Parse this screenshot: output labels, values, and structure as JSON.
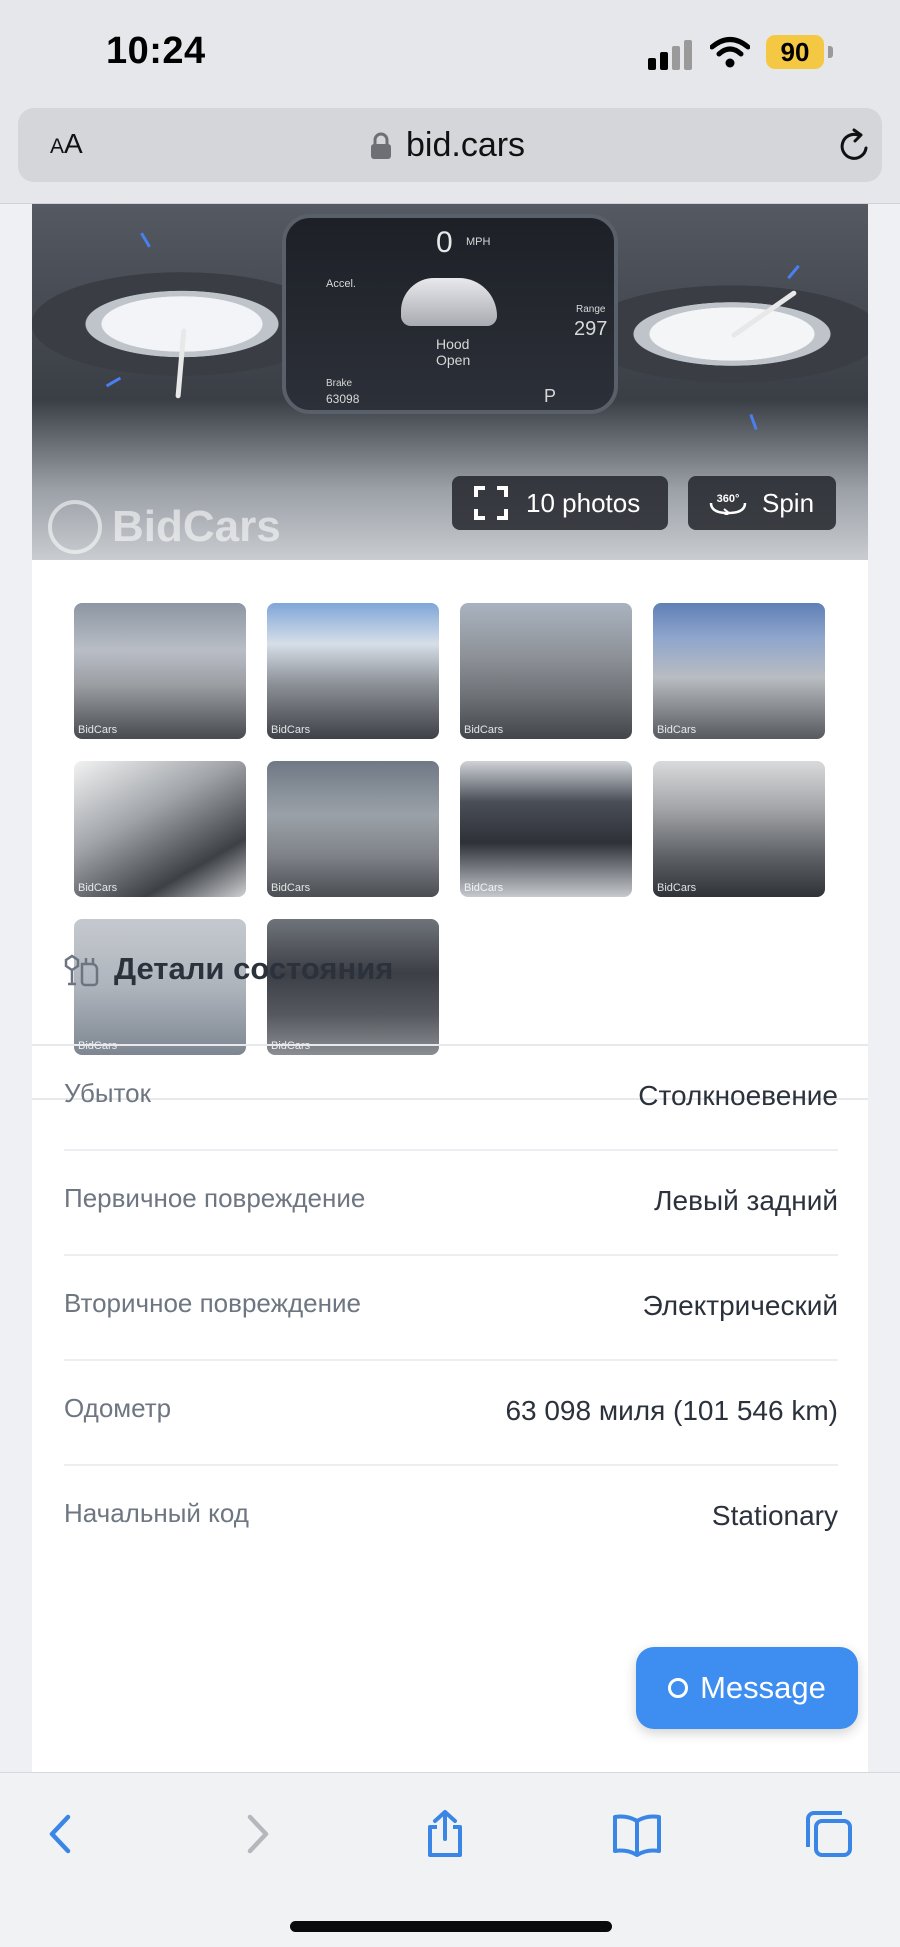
{
  "status_bar": {
    "time": "10:24",
    "battery": "90",
    "battery_color": "#f4c842"
  },
  "address_bar": {
    "text_size_small": "A",
    "text_size_large": "A",
    "url": "bid.cars",
    "lock_icon": "lock-icon",
    "reload_icon": "reload-icon"
  },
  "gallery": {
    "watermark": "BidCars",
    "dashboard": {
      "speed": "0",
      "speed_unit": "MPH",
      "center_text_1": "Hood",
      "center_text_2": "Open",
      "brake_label": "Brake",
      "odometer": "63098",
      "range_label": "Range",
      "range_value": "297",
      "gear": "P",
      "accel_label": "Accel."
    },
    "photos_button": "10 photos",
    "spin_button": "Spin",
    "spin_badge": "360°",
    "thumbnail_watermark": "BidCars",
    "thumbnail_count": 10
  },
  "section": {
    "title": "Детали состояния",
    "icon": "car-repair-icon"
  },
  "details": [
    {
      "label": "Убыток",
      "value": "Столкноевение"
    },
    {
      "label": "Первичное повреждение",
      "value": "Левый задний"
    },
    {
      "label": "Вторичное повреждение",
      "value": "Электрический"
    },
    {
      "label": "Одометр",
      "value": "63 098 миля (101 546 km)"
    },
    {
      "label": "Начальный код",
      "value": "Stationary"
    }
  ],
  "message_button": "Message",
  "accent_color": "#3d8ef0",
  "toolbar": {
    "back_icon": "back-chevron-icon",
    "forward_icon": "forward-chevron-icon",
    "share_icon": "share-icon",
    "bookmarks_icon": "bookmarks-icon",
    "tabs_icon": "tabs-icon"
  }
}
